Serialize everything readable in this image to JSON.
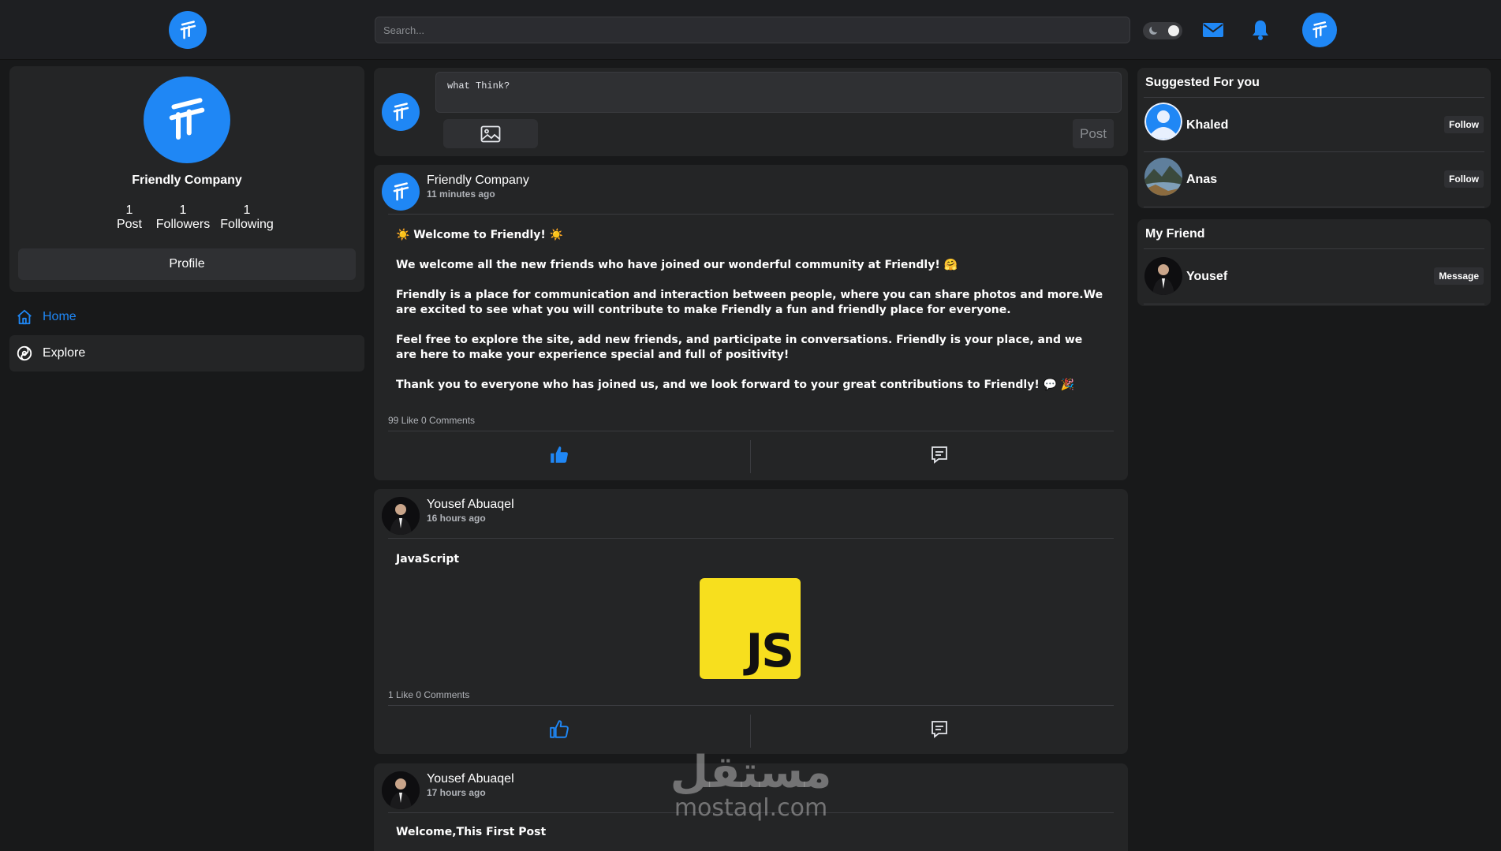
{
  "header": {
    "search_placeholder": "Search...",
    "icons": [
      "logo-icon",
      "moon-icon",
      "mail-icon",
      "bell-icon",
      "avatar"
    ]
  },
  "colors": {
    "accent": "#1f87f5",
    "background": "#18191a",
    "card": "#242526"
  },
  "profile": {
    "name": "Friendly Company",
    "stats": [
      {
        "value": "1",
        "label": "Post"
      },
      {
        "value": "1",
        "label": "Followers"
      },
      {
        "value": "1",
        "label": "Following"
      }
    ],
    "button_label": "Profile"
  },
  "nav": {
    "home": "Home",
    "explore": "Explore"
  },
  "composer": {
    "value": "what Think?",
    "post_label": "Post"
  },
  "posts": [
    {
      "author": "Friendly Company",
      "time": "11 minutes ago",
      "paragraphs": [
        "☀️ Welcome to Friendly! ☀️",
        "We welcome all the new friends who have joined our wonderful community at Friendly! 🤗",
        "Friendly is a place for communication and interaction between people, where you can share photos and more.We are excited to see what you will contribute to make Friendly a fun and friendly place for everyone.",
        "Feel free to explore the site, add new friends, and participate in conversations. Friendly is your place, and we are here to make your experience special and full of positivity!",
        "Thank you to everyone who has joined us, and we look forward to your great contributions to Friendly! 💬 🎉"
      ],
      "stats": "99 Like 0 Comments",
      "liked": true
    },
    {
      "author": "Yousef Abuaqel",
      "time": "16 hours ago",
      "paragraphs": [
        "JavaScript"
      ],
      "image_text": "JS",
      "stats": "1 Like 0 Comments",
      "liked": false
    },
    {
      "author": "Yousef Abuaqel",
      "time": "17 hours ago",
      "paragraphs": [
        "Welcome,This First Post"
      ]
    }
  ],
  "suggested": {
    "title": "Suggested For you",
    "people": [
      {
        "name": "Khaled",
        "action": "Follow"
      },
      {
        "name": "Anas",
        "action": "Follow"
      }
    ]
  },
  "friends": {
    "title": "My Friend",
    "people": [
      {
        "name": "Yousef",
        "action": "Message"
      }
    ]
  },
  "watermark": {
    "arabic": "مستقل",
    "latin": "mostaql.com"
  }
}
